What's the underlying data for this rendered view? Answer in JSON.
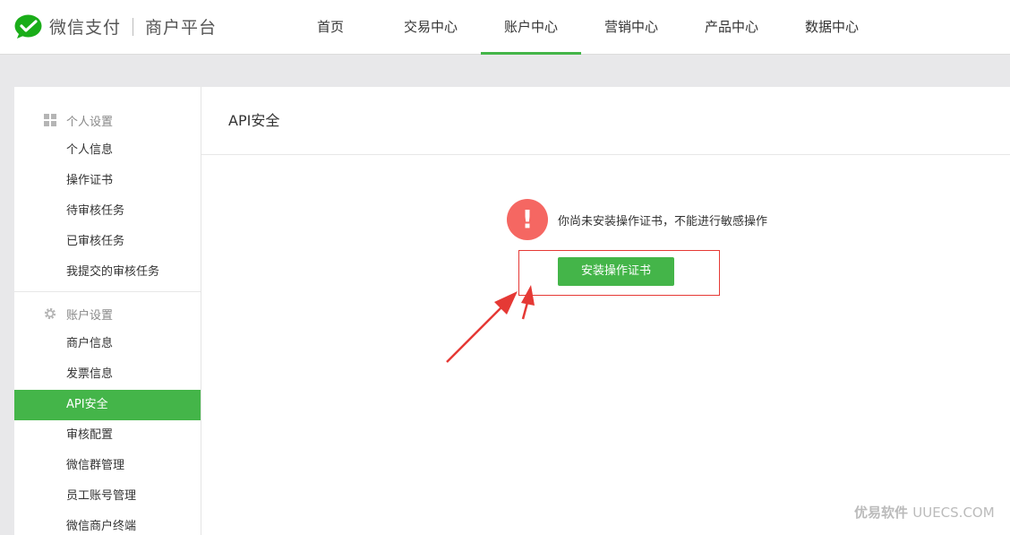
{
  "brand": {
    "name": "微信支付",
    "subtitle": "商户平台"
  },
  "nav": [
    {
      "label": "首页",
      "active": false
    },
    {
      "label": "交易中心",
      "active": false
    },
    {
      "label": "账户中心",
      "active": true
    },
    {
      "label": "营销中心",
      "active": false
    },
    {
      "label": "产品中心",
      "active": false
    },
    {
      "label": "数据中心",
      "active": false
    }
  ],
  "sidebar": {
    "groups": [
      {
        "title": "个人设置",
        "icon": "grid-icon",
        "items": [
          "个人信息",
          "操作证书",
          "待审核任务",
          "已审核任务",
          "我提交的审核任务"
        ]
      },
      {
        "title": "账户设置",
        "icon": "gear-icon",
        "items": [
          "商户信息",
          "发票信息",
          "API安全",
          "审核配置",
          "微信群管理",
          "员工账号管理",
          "微信商户终端"
        ]
      }
    ],
    "active_item": "API安全"
  },
  "main": {
    "title": "API安全",
    "warning_text": "你尚未安装操作证书，不能进行敏感操作",
    "warning_glyph": "!",
    "install_button": "安装操作证书"
  },
  "watermark": {
    "brand": "优易软件",
    "site": "UUECS.COM"
  },
  "colors": {
    "accent": "#44b549",
    "warning": "#f56762",
    "highlight": "#e53935"
  }
}
